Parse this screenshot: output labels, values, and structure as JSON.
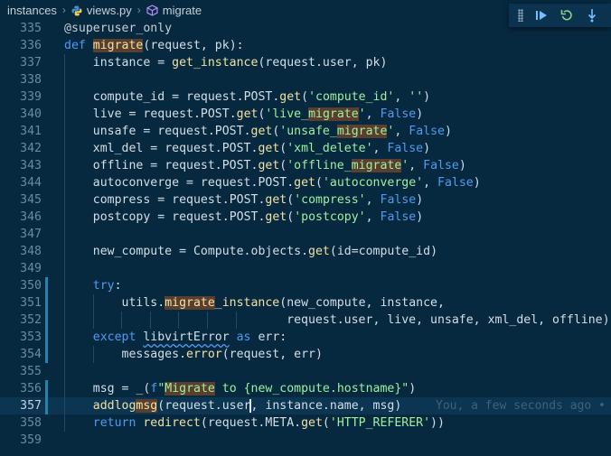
{
  "breadcrumb": [
    "instances",
    "views.py",
    "migrate"
  ],
  "toolbar": {
    "buttons": [
      {
        "name": "continue",
        "icon": "continue-icon"
      },
      {
        "name": "restart",
        "icon": "restart-icon"
      },
      {
        "name": "step-over",
        "icon": "step-over-icon"
      }
    ]
  },
  "editor": {
    "current_line": 357,
    "blame": "You, a few seconds ago •",
    "lines": [
      {
        "n": "335",
        "indent": 0,
        "text": "@superuser_only"
      },
      {
        "n": "336",
        "indent": 0,
        "text": "def migrate(request, pk):"
      },
      {
        "n": "337",
        "indent": 1,
        "text": "    instance = get_instance(request.user, pk)"
      },
      {
        "n": "338",
        "indent": 1,
        "text": ""
      },
      {
        "n": "339",
        "indent": 1,
        "text": "    compute_id = request.POST.get('compute_id', '')"
      },
      {
        "n": "340",
        "indent": 1,
        "text": "    live = request.POST.get('live_migrate', False)"
      },
      {
        "n": "341",
        "indent": 1,
        "text": "    unsafe = request.POST.get('unsafe_migrate', False)"
      },
      {
        "n": "342",
        "indent": 1,
        "text": "    xml_del = request.POST.get('xml_delete', False)"
      },
      {
        "n": "343",
        "indent": 1,
        "text": "    offline = request.POST.get('offline_migrate', False)"
      },
      {
        "n": "344",
        "indent": 1,
        "text": "    autoconverge = request.POST.get('autoconverge', False)"
      },
      {
        "n": "345",
        "indent": 1,
        "text": "    compress = request.POST.get('compress', False)"
      },
      {
        "n": "346",
        "indent": 1,
        "text": "    postcopy = request.POST.get('postcopy', False)"
      },
      {
        "n": "347",
        "indent": 1,
        "text": ""
      },
      {
        "n": "348",
        "indent": 1,
        "text": "    new_compute = Compute.objects.get(id=compute_id)"
      },
      {
        "n": "349",
        "indent": 1,
        "text": ""
      },
      {
        "n": "350",
        "indent": 1,
        "text": "    try:",
        "mod": true
      },
      {
        "n": "351",
        "indent": 2,
        "text": "        utils.migrate_instance(new_compute, instance,",
        "mod": true
      },
      {
        "n": "352",
        "indent": 7,
        "text": "                               request.user, live, unsafe, xml_del, offline)",
        "mod": true
      },
      {
        "n": "353",
        "indent": 1,
        "text": "    except libvirtError as err:",
        "mod": true
      },
      {
        "n": "354",
        "indent": 2,
        "text": "        messages.error(request, err)",
        "mod": true
      },
      {
        "n": "355",
        "indent": 1,
        "text": ""
      },
      {
        "n": "356",
        "indent": 1,
        "text": "    msg = _(f\"Migrate to {new_compute.hostname}\")",
        "mod": true
      },
      {
        "n": "357",
        "indent": 1,
        "text": "    addlogmsg(request.user, instance.name, msg)",
        "mod": true
      },
      {
        "n": "358",
        "indent": 1,
        "text": "    return redirect(request.META.get('HTTP_REFERER'))"
      },
      {
        "n": "359",
        "indent": 0,
        "text": ""
      }
    ]
  },
  "colors": {
    "background": "#062940",
    "keyword": "#4f9bf0",
    "function": "#f1e1a2",
    "string": "#9ef19f",
    "highlight": "#5a3f2e"
  }
}
